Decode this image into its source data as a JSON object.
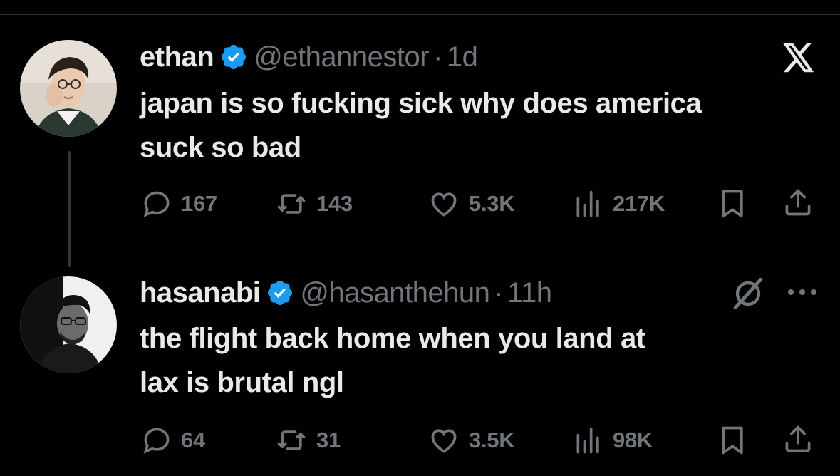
{
  "tweets": [
    {
      "name": "ethan",
      "handle": "@ethannestor",
      "separator": "·",
      "time": "1d",
      "text_lines": [
        "japan is so fucking sick why does america",
        "suck so bad"
      ],
      "replies": "167",
      "retweets": "143",
      "likes": "5.3K",
      "views": "217K",
      "verified": true,
      "top_right_icon": "x-logo-icon"
    },
    {
      "name": "hasanabi",
      "handle": "@hasanthehun",
      "separator": "·",
      "time": "11h",
      "text_lines": [
        "the flight back home when you land at",
        "lax is brutal ngl"
      ],
      "replies": "64",
      "retweets": "31",
      "likes": "3.5K",
      "views": "98K",
      "verified": true,
      "top_right_icon": "grok-icon"
    }
  ],
  "colors": {
    "background": "#000000",
    "text": "#e7e9ea",
    "muted": "#71767b",
    "verified": "#1d9bf0",
    "divider": "#2f3336"
  }
}
